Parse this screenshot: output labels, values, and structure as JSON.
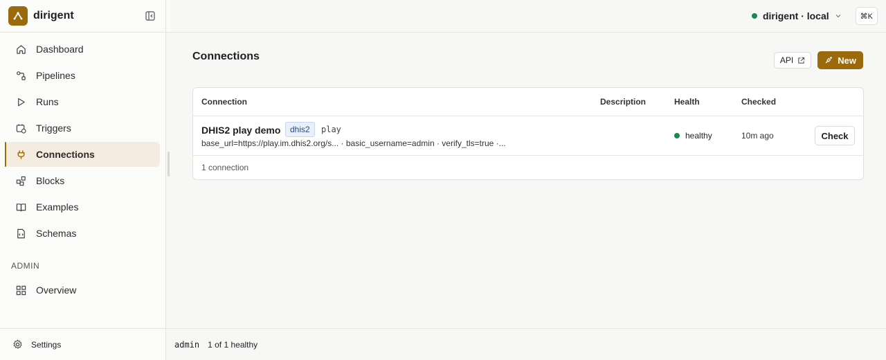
{
  "app": {
    "name": "dirigent"
  },
  "sidebar": {
    "items": [
      {
        "label": "Dashboard",
        "icon": "home-icon"
      },
      {
        "label": "Pipelines",
        "icon": "pipeline-icon"
      },
      {
        "label": "Runs",
        "icon": "play-icon"
      },
      {
        "label": "Triggers",
        "icon": "calendar-clock-icon"
      },
      {
        "label": "Connections",
        "icon": "plug-icon",
        "active": true
      },
      {
        "label": "Blocks",
        "icon": "blocks-icon"
      },
      {
        "label": "Examples",
        "icon": "book-icon"
      },
      {
        "label": "Schemas",
        "icon": "file-code-icon"
      }
    ],
    "admin_section": "ADMIN",
    "admin_items": [
      {
        "label": "Overview",
        "icon": "grid-icon"
      }
    ],
    "footer": {
      "label": "Settings",
      "icon": "gear-icon"
    }
  },
  "topbar": {
    "environment": "dirigent · local",
    "environment_status_color": "#1a8a55",
    "shortcut": "⌘K"
  },
  "page": {
    "title": "Connections",
    "api_button": "API",
    "new_button": "New"
  },
  "table": {
    "columns": {
      "connection": "Connection",
      "description": "Description",
      "health": "Health",
      "checked": "Checked"
    },
    "rows": [
      {
        "name": "DHIS2 play demo",
        "type_tag": "dhis2",
        "label_tag": "play",
        "config": "base_url=https://play.im.dhis2.org/s... · basic_username=admin · verify_tls=true ·...",
        "description": "",
        "health": "healthy",
        "checked": "10m ago",
        "action": "Check"
      }
    ],
    "footer": "1 connection"
  },
  "status": {
    "user": "admin",
    "summary": "1 of 1 healthy"
  },
  "colors": {
    "accent": "#9a6a0c",
    "healthy": "#1a8a55"
  }
}
